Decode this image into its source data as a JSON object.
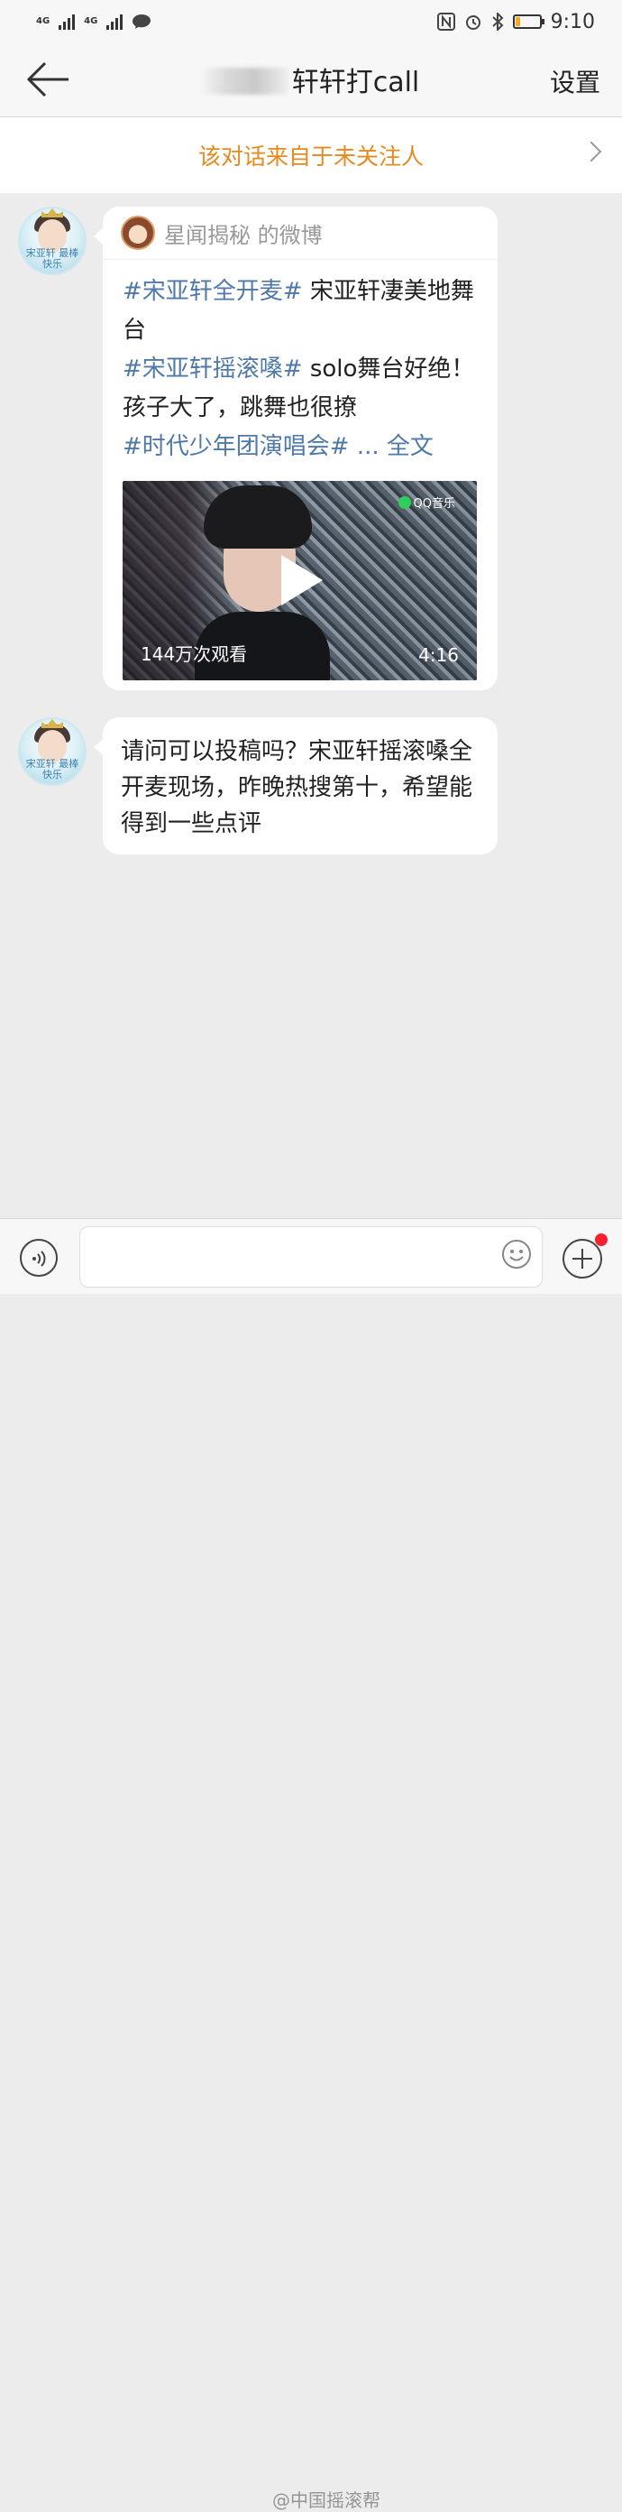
{
  "status_bar": {
    "network_1": "4G",
    "network_2": "4G",
    "time": "9:10",
    "battery_level": 0.2
  },
  "header": {
    "title_suffix": "轩轩打call",
    "settings_label": "设置"
  },
  "notice": {
    "text": "该对话来自于未关注人"
  },
  "messages": [
    {
      "avatar_text": "宋亚轩 最棒快乐",
      "card": {
        "source": "星闻揭秘 的微博",
        "tag1": "#宋亚轩全开麦#",
        "text1": " 宋亚轩凄美地舞台",
        "tag2": "#宋亚轩摇滚嗓#",
        "text2": " solo舞台好绝！孩子大了，跳舞也很撩",
        "tag3": "#时代少年团演唱会#",
        "more": " ... 全文",
        "video": {
          "views": "144万次观看",
          "duration": "4:16",
          "logo": "QQ音乐"
        }
      }
    },
    {
      "avatar_text": "宋亚轩 最棒快乐",
      "text": "请问可以投稿吗？宋亚轩摇滚嗓全开麦现场，昨晚热搜第十，希望能得到一些点评"
    }
  ],
  "input": {
    "placeholder": ""
  },
  "watermark": "@中国摇滚帮",
  "colors": {
    "notice_text": "#e58a1f",
    "hashtag": "#4f79a8",
    "badge": "#f5222d"
  }
}
